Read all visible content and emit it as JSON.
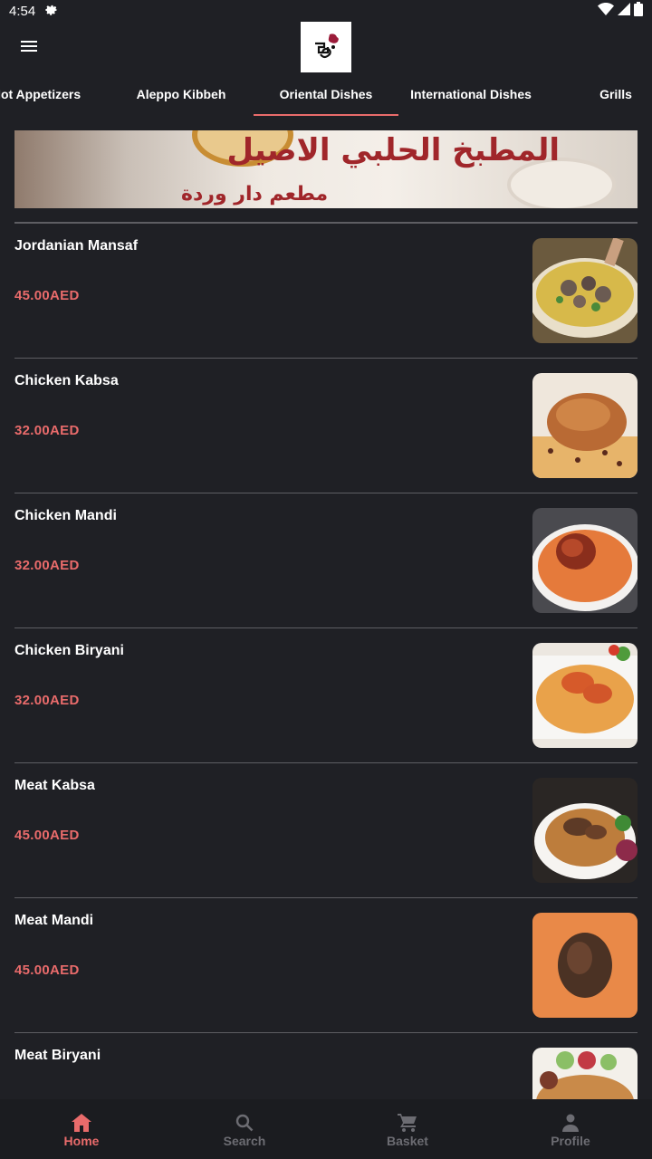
{
  "status_bar": {
    "time": "4:54"
  },
  "app_bar": {
    "logo_alt": "دار وردة"
  },
  "tabs": [
    {
      "label": "Hot Appetizers"
    },
    {
      "label": "Aleppo Kibbeh"
    },
    {
      "label": "Oriental Dishes",
      "active": true
    },
    {
      "label": "International Dishes"
    },
    {
      "label": "Grills"
    }
  ],
  "banner": {
    "title": "المطبخ الحلبي الاصيل",
    "subtitle": "مطعم دار وردة"
  },
  "menu_items": [
    {
      "name": "Jordanian Mansaf",
      "price": "45.00AED"
    },
    {
      "name": "Chicken Kabsa",
      "price": "32.00AED"
    },
    {
      "name": "Chicken Mandi",
      "price": "32.00AED"
    },
    {
      "name": "Chicken Biryani",
      "price": "32.00AED"
    },
    {
      "name": "Meat Kabsa",
      "price": "45.00AED"
    },
    {
      "name": "Meat Mandi",
      "price": "45.00AED"
    },
    {
      "name": "Meat Biryani",
      "price": ""
    }
  ],
  "bottom_nav": [
    {
      "label": "Home",
      "icon": "home-icon",
      "active": true
    },
    {
      "label": "Search",
      "icon": "search-icon"
    },
    {
      "label": "Basket",
      "icon": "cart-icon"
    },
    {
      "label": "Profile",
      "icon": "person-icon"
    }
  ],
  "colors": {
    "background": "#1f2025",
    "accent": "#e96b6b",
    "divider": "#5e5e63",
    "nav_inactive": "#6c6c72"
  }
}
